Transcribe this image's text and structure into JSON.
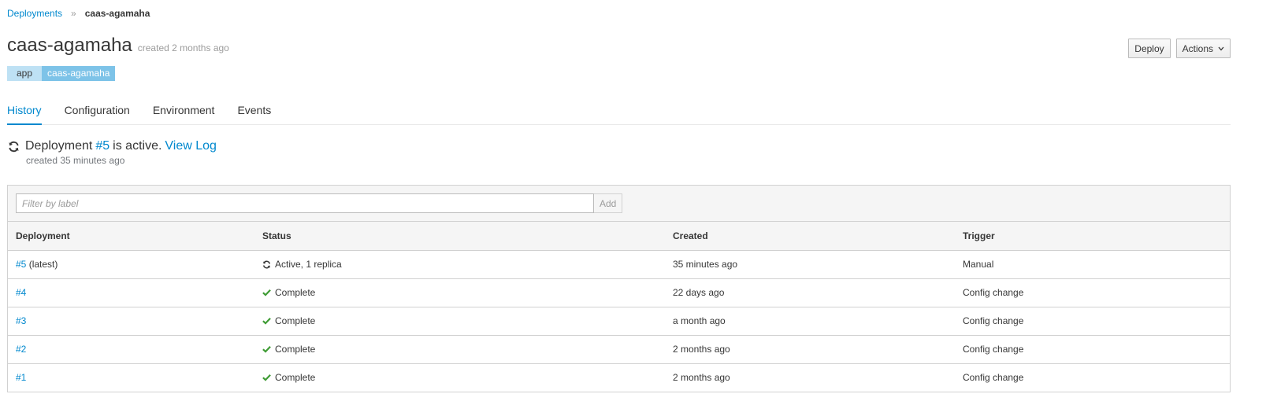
{
  "breadcrumb": {
    "parent": "Deployments",
    "separator": "»",
    "current": "caas-agamaha"
  },
  "header": {
    "title": "caas-agamaha",
    "subtitle": "created 2 months ago"
  },
  "labels": [
    {
      "key": "app",
      "value": "caas-agamaha"
    }
  ],
  "actions": {
    "deploy": "Deploy",
    "actions": "Actions"
  },
  "tabs": [
    {
      "label": "History",
      "active": true
    },
    {
      "label": "Configuration"
    },
    {
      "label": "Environment"
    },
    {
      "label": "Events"
    }
  ],
  "status": {
    "prefix": "Deployment",
    "number": "#5",
    "middle": "is active.",
    "view_log": "View Log",
    "created": "created 35 minutes ago"
  },
  "filter": {
    "placeholder": "Filter by label",
    "add": "Add"
  },
  "table": {
    "headers": {
      "deployment": "Deployment",
      "status": "Status",
      "created": "Created",
      "trigger": "Trigger"
    },
    "rows": [
      {
        "id": "#5",
        "suffix": "(latest)",
        "status": "Active, 1 replica",
        "status_icon": "sync-icon",
        "created": "35 minutes ago",
        "trigger": "Manual"
      },
      {
        "id": "#4",
        "suffix": "",
        "status": "Complete",
        "status_icon": "check-icon",
        "created": "22 days ago",
        "trigger": "Config change"
      },
      {
        "id": "#3",
        "suffix": "",
        "status": "Complete",
        "status_icon": "check-icon",
        "created": "a month ago",
        "trigger": "Config change"
      },
      {
        "id": "#2",
        "suffix": "",
        "status": "Complete",
        "status_icon": "check-icon",
        "created": "2 months ago",
        "trigger": "Config change"
      },
      {
        "id": "#1",
        "suffix": "",
        "status": "Complete",
        "status_icon": "check-icon",
        "created": "2 months ago",
        "trigger": "Config change"
      }
    ]
  },
  "colors": {
    "link": "#0088ce",
    "success": "#3f9c35",
    "label_key_bg": "#bee1f4",
    "label_value_bg": "#7dc3e8"
  }
}
